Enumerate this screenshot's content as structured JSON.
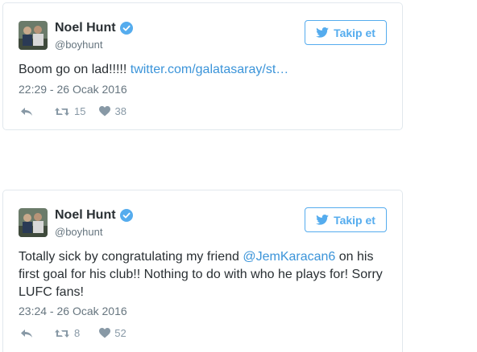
{
  "tweets": [
    {
      "name": "Noel Hunt",
      "handle": "@boyhunt",
      "follow_label": "Takip et",
      "text_plain": "Boom go on lad!!!!! ",
      "link": "twitter.com/galatasaray/st…",
      "date": "22:29 - 26 Ocak 2016",
      "retweets": "15",
      "likes": "38"
    },
    {
      "name": "Noel Hunt",
      "handle": "@boyhunt",
      "follow_label": "Takip et",
      "text_before": "Totally sick by congratulating my friend ",
      "mention": "@JemKaracan6",
      "text_line1_after": " on his",
      "text_line2": "first goal for his club!! Nothing to do with who he plays for! Sorry",
      "text_line3": "LUFC fans!",
      "date": "23:24 - 26 Ocak 2016",
      "retweets": "8",
      "likes": "52"
    }
  ],
  "colors": {
    "accent": "#55acee",
    "link": "#3b94d9",
    "muted": "#8899a6",
    "text": "#292f33"
  },
  "icons": [
    "verified-icon",
    "twitter-bird-icon",
    "reply-icon",
    "retweet-icon",
    "heart-icon"
  ]
}
